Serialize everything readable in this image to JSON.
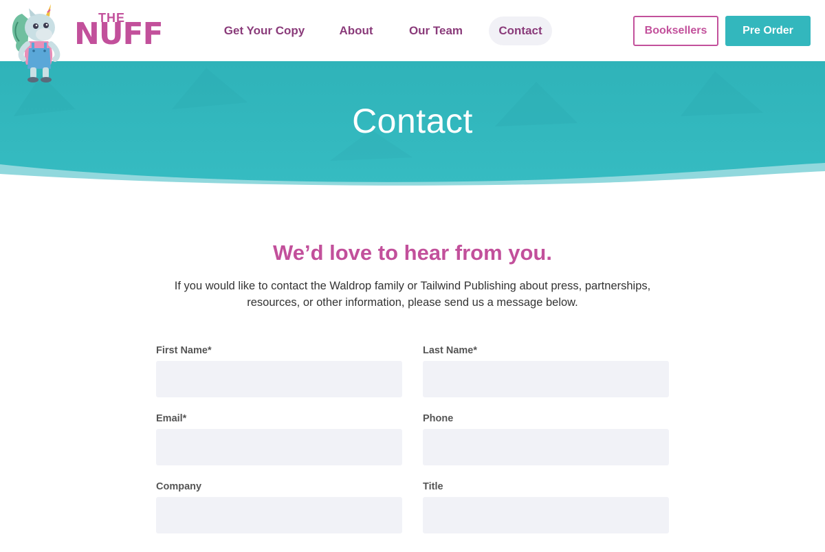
{
  "header": {
    "logo": {
      "small_text": "THE",
      "large_text": "NUFF"
    },
    "nav": [
      {
        "label": "Get Your Copy",
        "active": false
      },
      {
        "label": "About",
        "active": false
      },
      {
        "label": "Our Team",
        "active": false
      },
      {
        "label": "Contact",
        "active": true
      }
    ],
    "booksellers_label": "Booksellers",
    "preorder_label": "Pre Order"
  },
  "hero": {
    "title": "Contact"
  },
  "intro": {
    "heading": "We’d love to hear from you.",
    "text_line1": "If you would like to contact the Waldrop family or Tailwind Publishing about press, partnerships,",
    "text_line2": "resources, or other information, please send us a message below."
  },
  "form": {
    "first_name_label": "First Name*",
    "last_name_label": "Last Name*",
    "email_label": "Email*",
    "phone_label": "Phone",
    "company_label": "Company",
    "title_label": "Title",
    "first_name_value": "",
    "last_name_value": "",
    "email_value": "",
    "phone_value": "",
    "company_value": "",
    "title_value": ""
  },
  "colors": {
    "brand_pink": "#c2509b",
    "nav_purple": "#8a3b7a",
    "teal": "#33b7bd",
    "input_bg": "#f1f2f7"
  }
}
